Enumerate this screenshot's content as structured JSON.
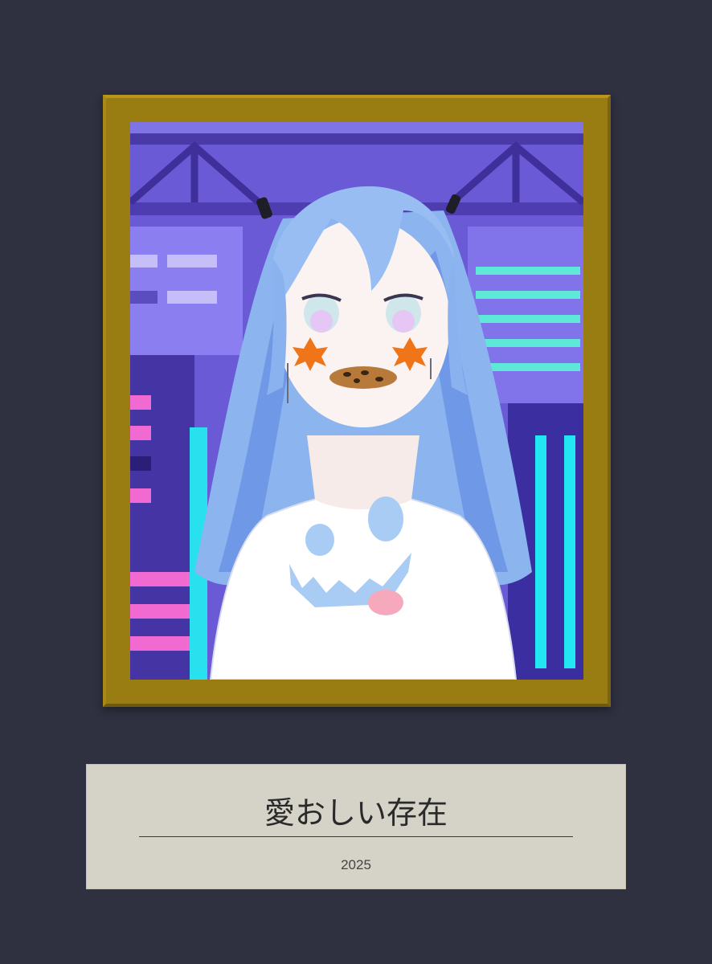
{
  "plaque": {
    "title": "愛おしい存在",
    "year": "2025"
  },
  "colors": {
    "background": "#2f3040",
    "frame": "#9a7d12",
    "plaque": "#d5d3c8"
  }
}
